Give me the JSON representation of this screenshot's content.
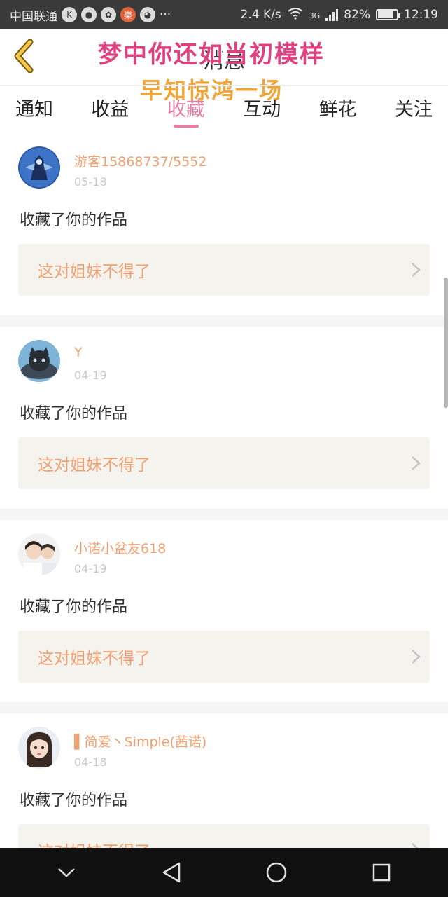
{
  "status_bar": {
    "carrier": "中国联通",
    "net_speed": "2.4 K/s",
    "network_type": "3G",
    "battery": "82%",
    "battery_level": 0.82,
    "time": "12:19"
  },
  "header": {
    "title": "消息",
    "overlay_line1": "梦中你还如当初模样",
    "overlay_line2": "早知惊鸿一场"
  },
  "tabs": [
    {
      "label": "通知",
      "active": false
    },
    {
      "label": "收益",
      "active": false
    },
    {
      "label": "收藏",
      "active": true
    },
    {
      "label": "互动",
      "active": false
    },
    {
      "label": "鲜花",
      "active": false
    },
    {
      "label": "关注",
      "active": false
    }
  ],
  "cards": [
    {
      "username": "游客15868737/5552",
      "date": "05-18",
      "action": "收藏了你的作品",
      "work_title": "这对姐妹不得了",
      "avatar": "robot-avatar"
    },
    {
      "username": "Y",
      "date": "04-19",
      "action": "收藏了你的作品",
      "work_title": "这对姐妹不得了",
      "avatar": "cat-avatar"
    },
    {
      "username": "小诺小盆友618",
      "date": "04-19",
      "action": "收藏了你的作品",
      "work_title": "这对姐妹不得了",
      "avatar": "people-avatar"
    },
    {
      "username": "▌简爱丶Simple(茜诺)",
      "date": "04-18",
      "action": "收藏了你的作品",
      "work_title": "这对姐妹不得了",
      "avatar": "girl-avatar"
    }
  ],
  "colors": {
    "accent_pink": "#e67fa3",
    "username_orange": "#f0a070",
    "work_bg": "#f4f3ee",
    "back_arrow": "#f2c94c"
  }
}
